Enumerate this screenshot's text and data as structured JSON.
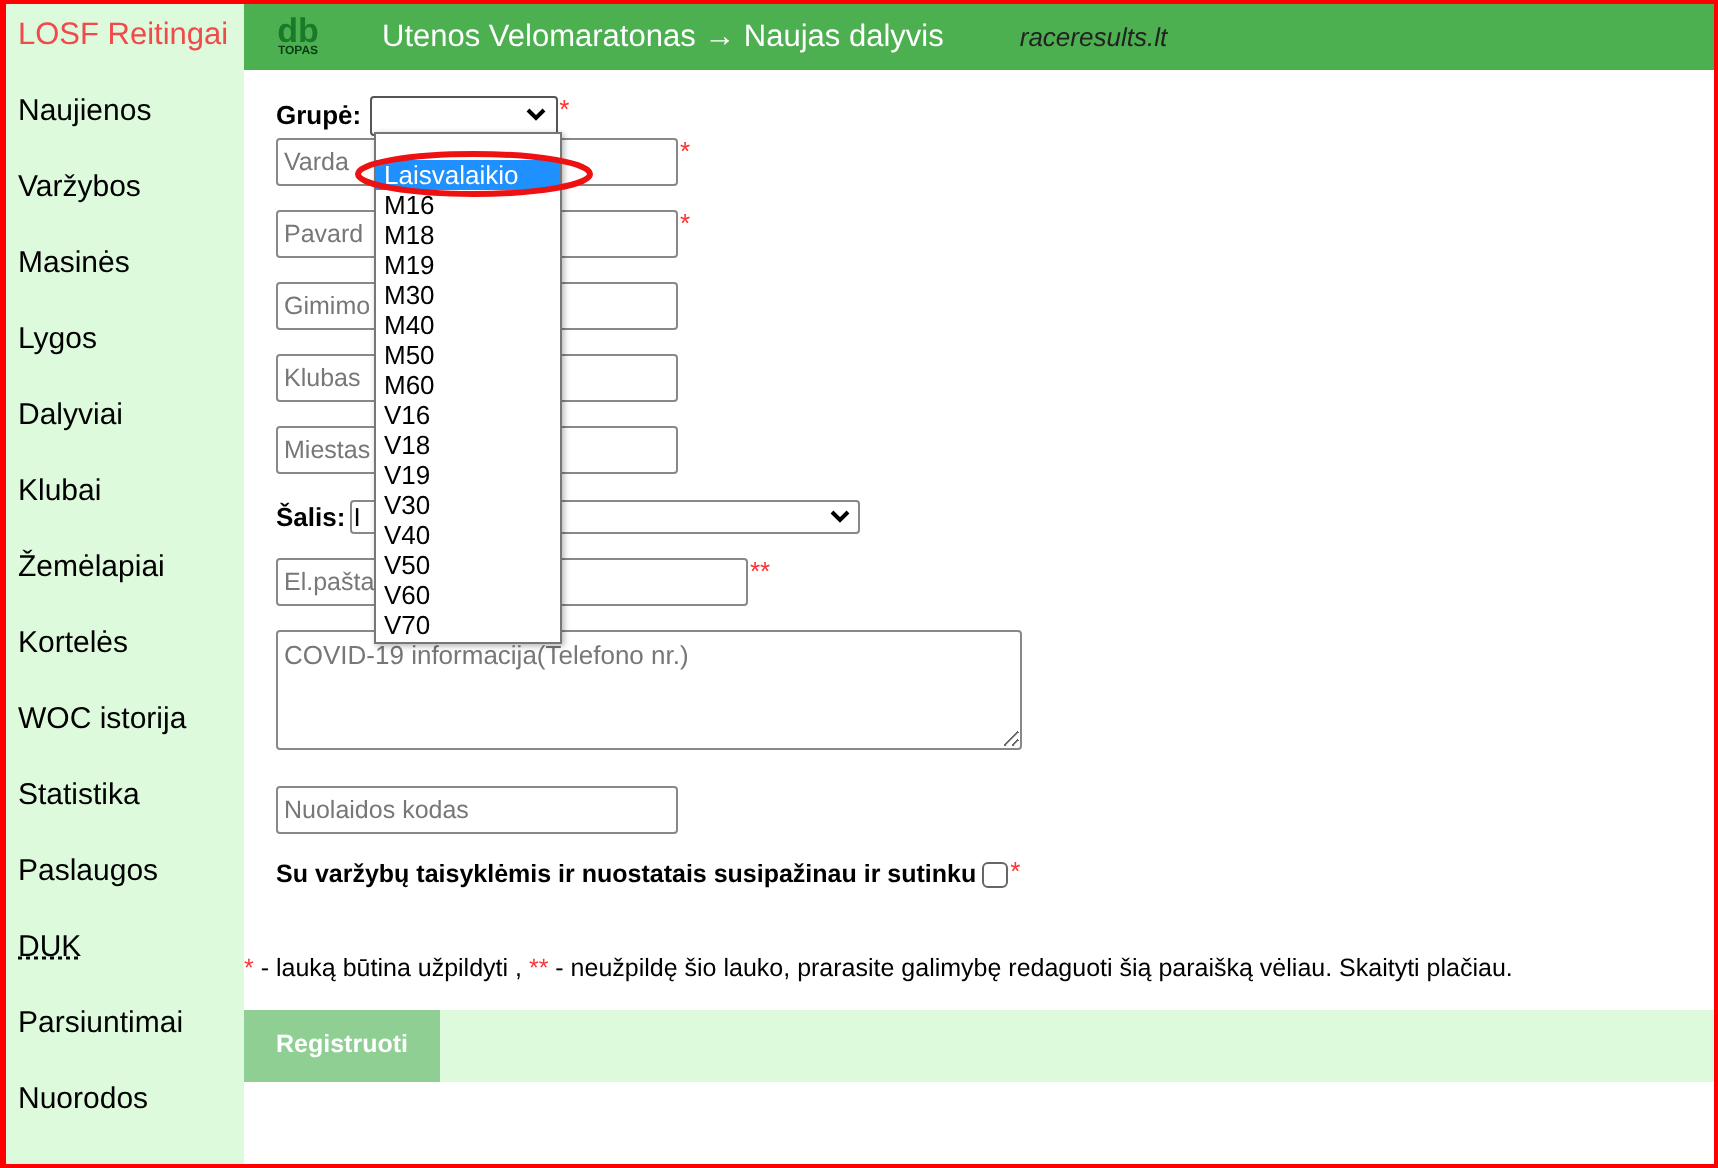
{
  "sidebar": {
    "title": "LOSF Reitingai",
    "items": [
      {
        "label": "Naujienos",
        "kind": "link"
      },
      {
        "label": "Varžybos",
        "kind": "link"
      },
      {
        "label": "Masinės",
        "kind": "link"
      },
      {
        "label": "Lygos",
        "kind": "link"
      },
      {
        "label": "Dalyviai",
        "kind": "link"
      },
      {
        "label": "Klubai",
        "kind": "link"
      },
      {
        "label": "Žemėlapiai",
        "kind": "link"
      },
      {
        "label": "Kortelės",
        "kind": "link"
      },
      {
        "label": "WOC istorija",
        "kind": "link"
      },
      {
        "label": "Statistika",
        "kind": "link"
      },
      {
        "label": "Paslaugos",
        "kind": "link"
      },
      {
        "label": "DUK",
        "kind": "abbr"
      },
      {
        "label": "Parsiuntimai",
        "kind": "link"
      },
      {
        "label": "Nuorodos",
        "kind": "link"
      }
    ]
  },
  "header": {
    "logo": "db",
    "logo_sub": "TOPAS",
    "title": "Utenos Velomaratonas → Naujas dalyvis",
    "site": "raceresults.lt"
  },
  "form": {
    "group": {
      "label": "Grupė:",
      "required": "*",
      "expanded": true,
      "options": [
        {
          "label": "Laisvalaikio",
          "selected": true
        },
        {
          "label": "M16",
          "selected": false
        },
        {
          "label": "M18",
          "selected": false
        },
        {
          "label": "M19",
          "selected": false
        },
        {
          "label": "M30",
          "selected": false
        },
        {
          "label": "M40",
          "selected": false
        },
        {
          "label": "M50",
          "selected": false
        },
        {
          "label": "M60",
          "selected": false
        },
        {
          "label": "V16",
          "selected": false
        },
        {
          "label": "V18",
          "selected": false
        },
        {
          "label": "V19",
          "selected": false
        },
        {
          "label": "V30",
          "selected": false
        },
        {
          "label": "V40",
          "selected": false
        },
        {
          "label": "V50",
          "selected": false
        },
        {
          "label": "V60",
          "selected": false
        },
        {
          "label": "V70",
          "selected": false
        }
      ]
    },
    "fields_top": [
      {
        "placeholder": "Varda",
        "required": "*"
      },
      {
        "placeholder": "Pavard",
        "required": "*"
      },
      {
        "placeholder": "Gimimo"
      },
      {
        "placeholder": "Klubas"
      },
      {
        "placeholder": "Miestas"
      }
    ],
    "country": {
      "label": "Šalis:",
      "value": "I"
    },
    "email": {
      "placeholder": "El.pašta",
      "required": "**"
    },
    "covid": {
      "placeholder": "COVID-19 informacija(Telefono nr.)"
    },
    "discount": {
      "placeholder": "Nuolaidos kodas"
    },
    "consent": {
      "label": "Su varžybų taisyklėmis ir nuostatais susipažinau ir sutinku",
      "checked": false,
      "required": "*"
    },
    "legend": [
      {
        "mark": "*",
        "text": " - lauką būtina užpildyti , "
      },
      {
        "mark": "**",
        "text": " - neužpildę šio lauko, prarasite galimybę redaguoti šią paraišką vėliau. Skaityti plačiau."
      }
    ],
    "submit": {
      "label": "Registruoti",
      "disabled": true
    }
  }
}
